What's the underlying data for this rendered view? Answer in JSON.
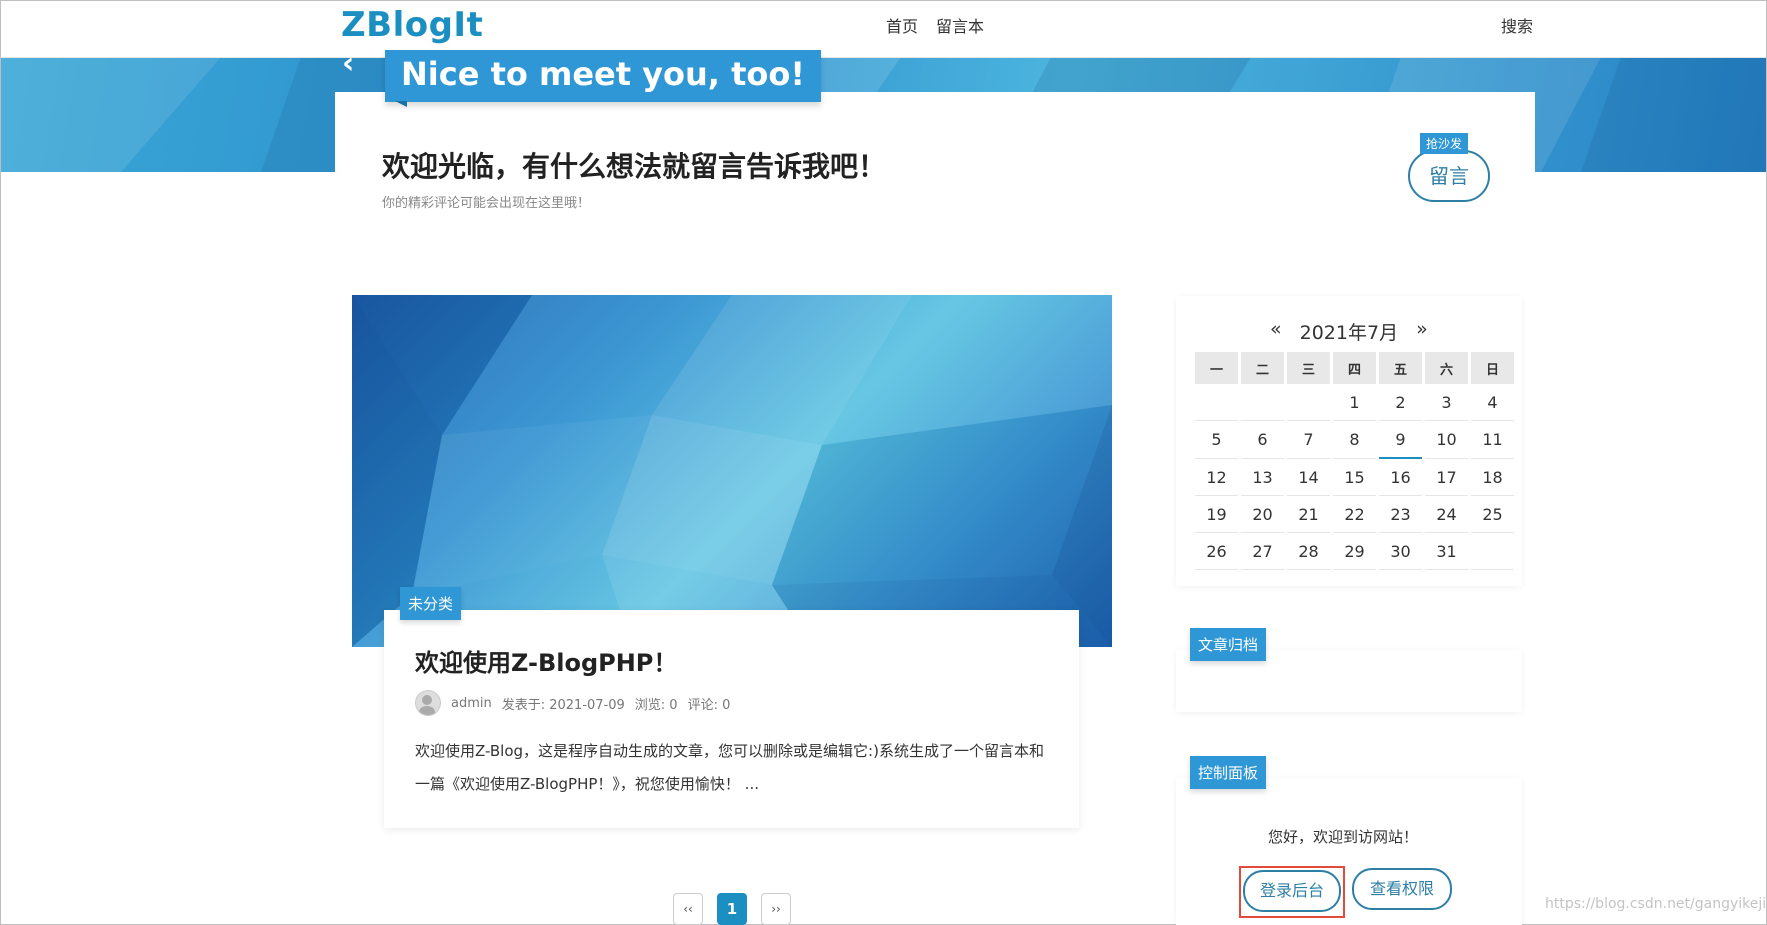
{
  "header": {
    "logo": "ZBlogIt",
    "nav": [
      "首页",
      "留言本"
    ],
    "search": "搜索"
  },
  "guestbook": {
    "banner_title": "Nice to meet you, too!",
    "welcome_title": "欢迎光临，有什么想法就留言告诉我吧！",
    "welcome_subtitle": "你的精彩评论可能会出现在这里哦！",
    "sofa_badge": "抢沙发",
    "comment_button": "留言"
  },
  "post": {
    "category": "未分类",
    "title": "欢迎使用Z-BlogPHP！",
    "author": "admin",
    "published": "发表于: 2021-07-09",
    "views": "浏览: 0",
    "comments": "评论: 0",
    "excerpt": "欢迎使用Z-Blog，这是程序自动生成的文章，您可以删除或是编辑它:)系统生成了一个留言本和一篇《欢迎使用Z-BlogPHP！》，祝您使用愉快！ ..."
  },
  "pagination": {
    "prev": "‹‹",
    "current": "1",
    "next": "››"
  },
  "calendar": {
    "prev": "«",
    "month": "2021年7月",
    "next": "»",
    "weekdays": [
      "一",
      "二",
      "三",
      "四",
      "五",
      "六",
      "日"
    ],
    "weeks": [
      [
        "",
        "",
        "",
        "1",
        "2",
        "3",
        "4"
      ],
      [
        "5",
        "6",
        "7",
        "8",
        "9",
        "10",
        "11"
      ],
      [
        "12",
        "13",
        "14",
        "15",
        "16",
        "17",
        "18"
      ],
      [
        "19",
        "20",
        "21",
        "22",
        "23",
        "24",
        "25"
      ],
      [
        "26",
        "27",
        "28",
        "29",
        "30",
        "31",
        ""
      ]
    ]
  },
  "archive_widget": {
    "title": "文章归档"
  },
  "control_panel": {
    "title": "控制面板",
    "greeting": "您好，欢迎到访网站！",
    "login_button": "登录后台",
    "permissions_button": "查看权限"
  },
  "watermark": "https://blog.csdn.net/gangyikeji",
  "colors": {
    "accent": "#2f97d6",
    "logo": "#1c8fc2",
    "highlight": "#e24b3a"
  }
}
